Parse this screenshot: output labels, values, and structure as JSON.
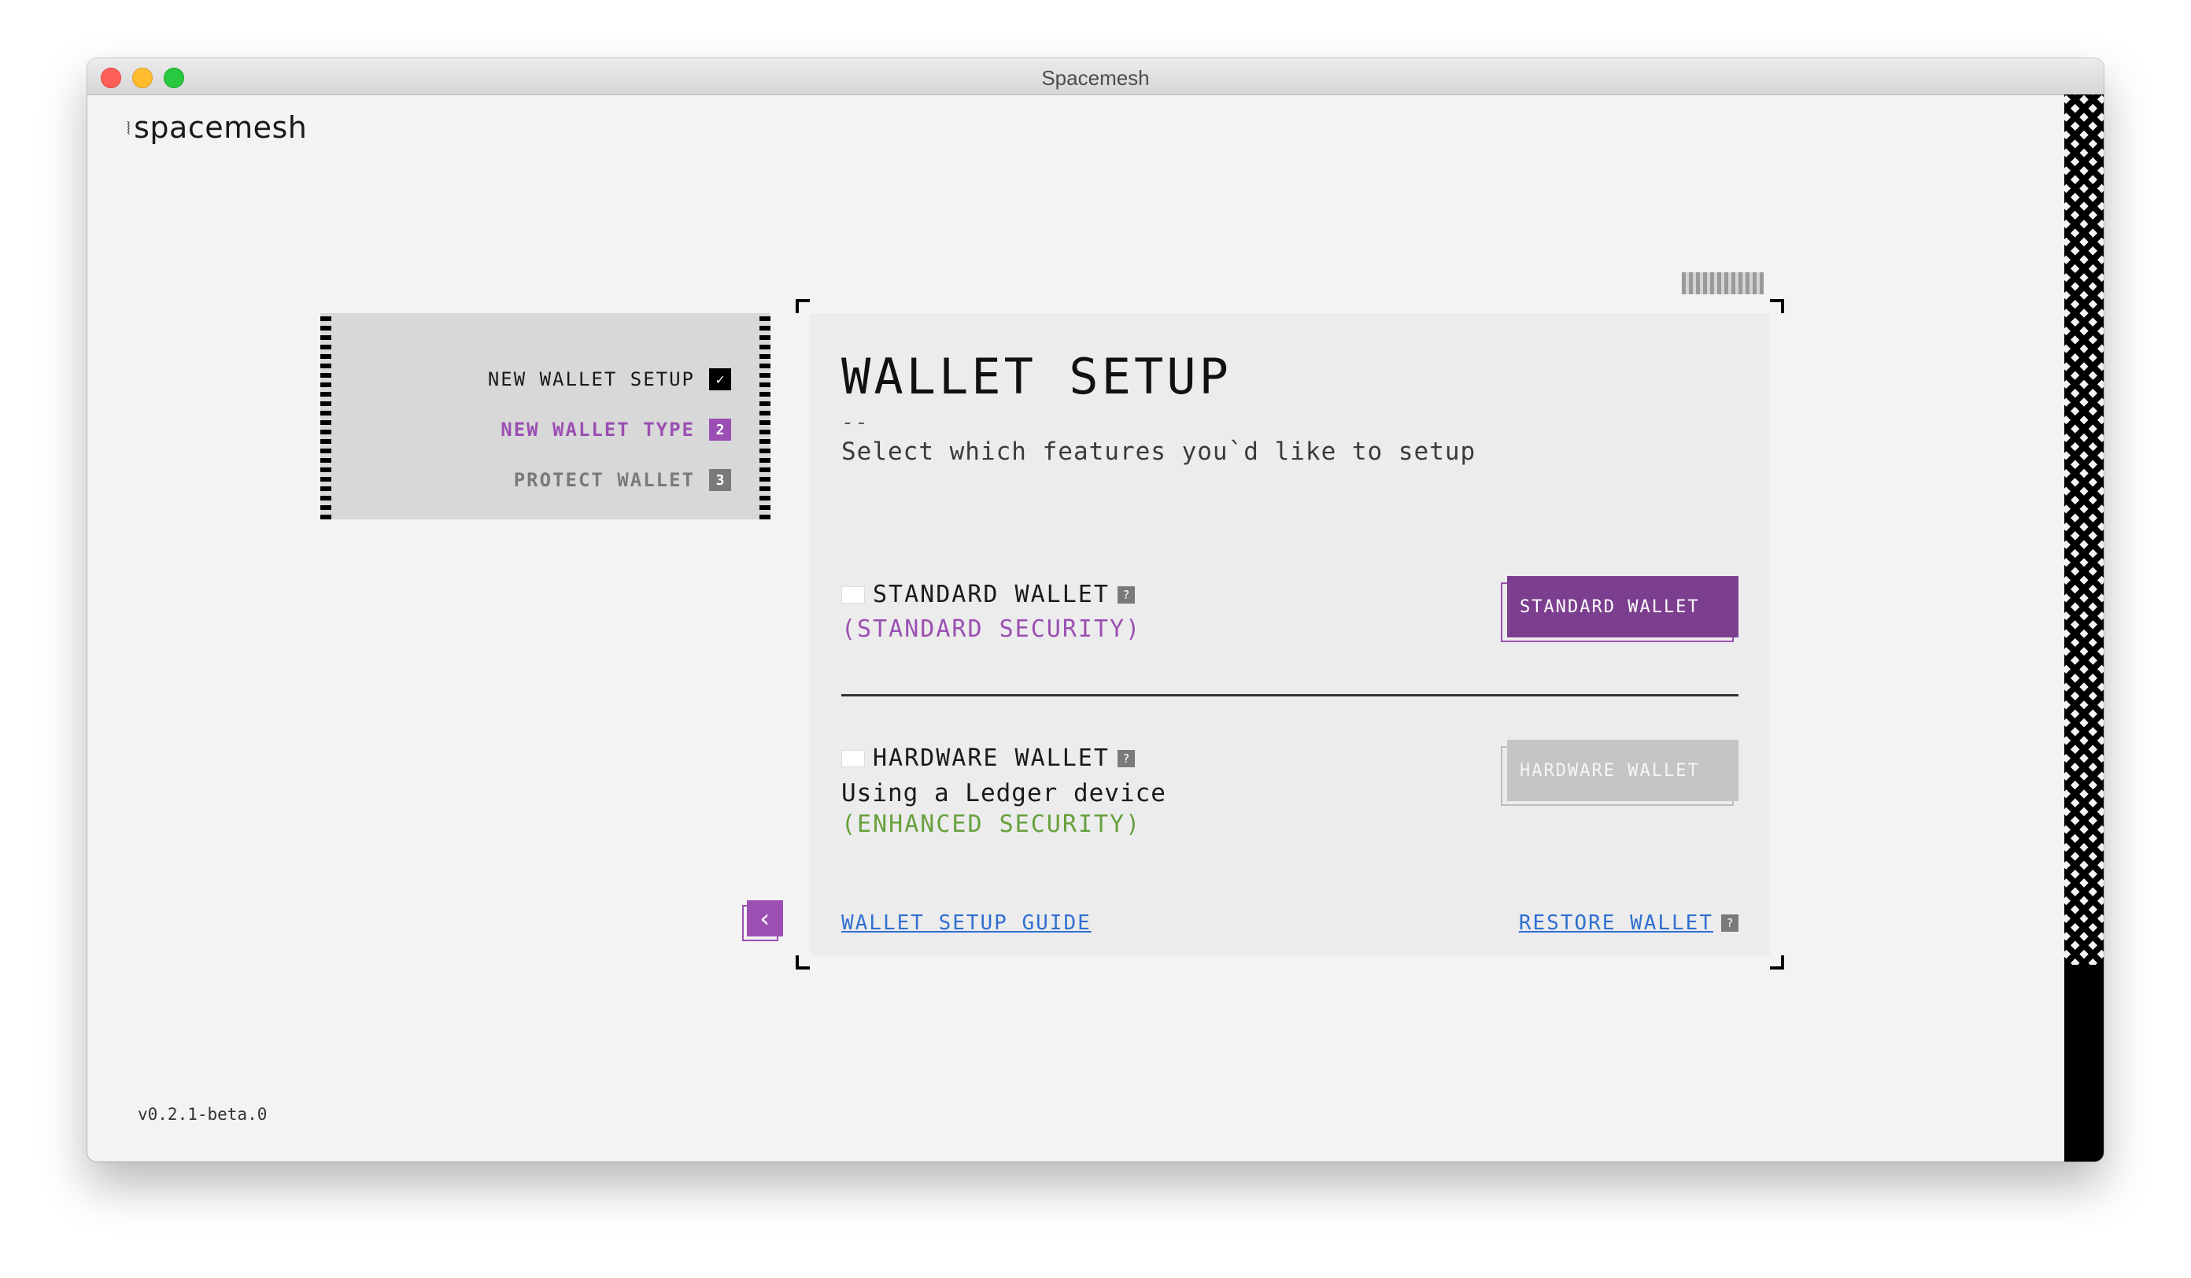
{
  "window": {
    "title": "Spacemesh"
  },
  "app": {
    "logo": "spacemesh",
    "logo_mark": "⦚",
    "version": "v0.2.1-beta.0"
  },
  "steps": [
    {
      "label": "NEW WALLET SETUP",
      "badge": "✓",
      "state": "done"
    },
    {
      "label": "NEW WALLET TYPE",
      "badge": "2",
      "state": "current"
    },
    {
      "label": "PROTECT WALLET",
      "badge": "3",
      "state": "pending"
    }
  ],
  "back_button": {
    "icon": "chevron-left-icon",
    "glyph": "‹"
  },
  "card": {
    "title": "WALLET SETUP",
    "dash": "--",
    "subtitle": "Select which features you`d like to setup",
    "standard": {
      "title": "STANDARD WALLET",
      "help": "?",
      "security": "(STANDARD SECURITY)",
      "button": "STANDARD WALLET"
    },
    "hardware": {
      "title": "HARDWARE WALLET",
      "help": "?",
      "description": "Using a Ledger device",
      "security": "(ENHANCED SECURITY)",
      "button": "HARDWARE WALLET"
    },
    "guide_link": "WALLET SETUP GUIDE",
    "restore_link": "RESTORE WALLET",
    "restore_help": "?"
  },
  "colors": {
    "accent": "#9b4fb3",
    "button": "#7c3f8f",
    "enhanced": "#67a03c",
    "link": "#2f6fd0"
  }
}
